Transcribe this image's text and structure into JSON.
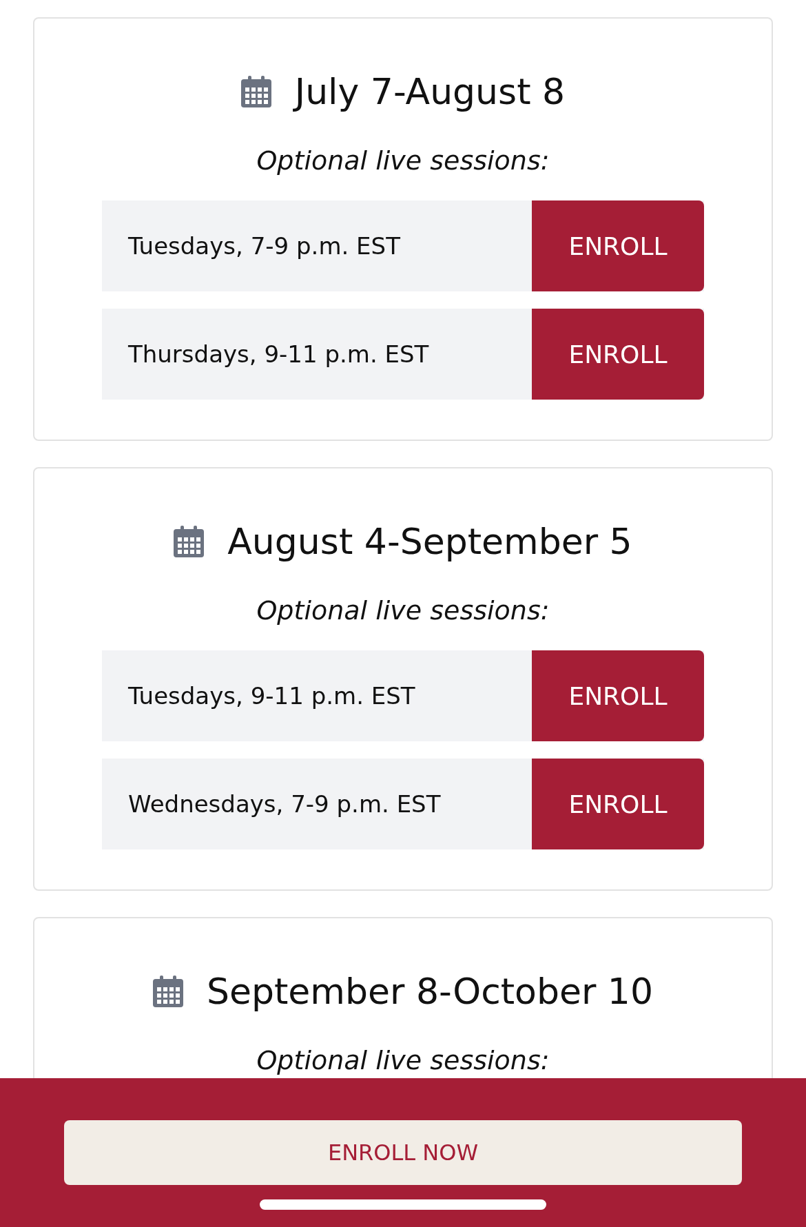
{
  "sessions": [
    {
      "dates": "July 7-August 8",
      "subtitle": "Optional live sessions:",
      "times": [
        {
          "label": "Tuesdays, 7-9 p.m. EST",
          "button": "ENROLL"
        },
        {
          "label": "Thursdays, 9-11 p.m. EST",
          "button": "ENROLL"
        }
      ]
    },
    {
      "dates": "August 4-September 5",
      "subtitle": "Optional live sessions:",
      "times": [
        {
          "label": "Tuesdays, 9-11 p.m. EST",
          "button": "ENROLL"
        },
        {
          "label": "Wednesdays, 7-9 p.m. EST",
          "button": "ENROLL"
        }
      ]
    },
    {
      "dates": "September 8-October 10",
      "subtitle": "Optional live sessions:"
    }
  ],
  "footer": {
    "button": "ENROLL NOW"
  }
}
